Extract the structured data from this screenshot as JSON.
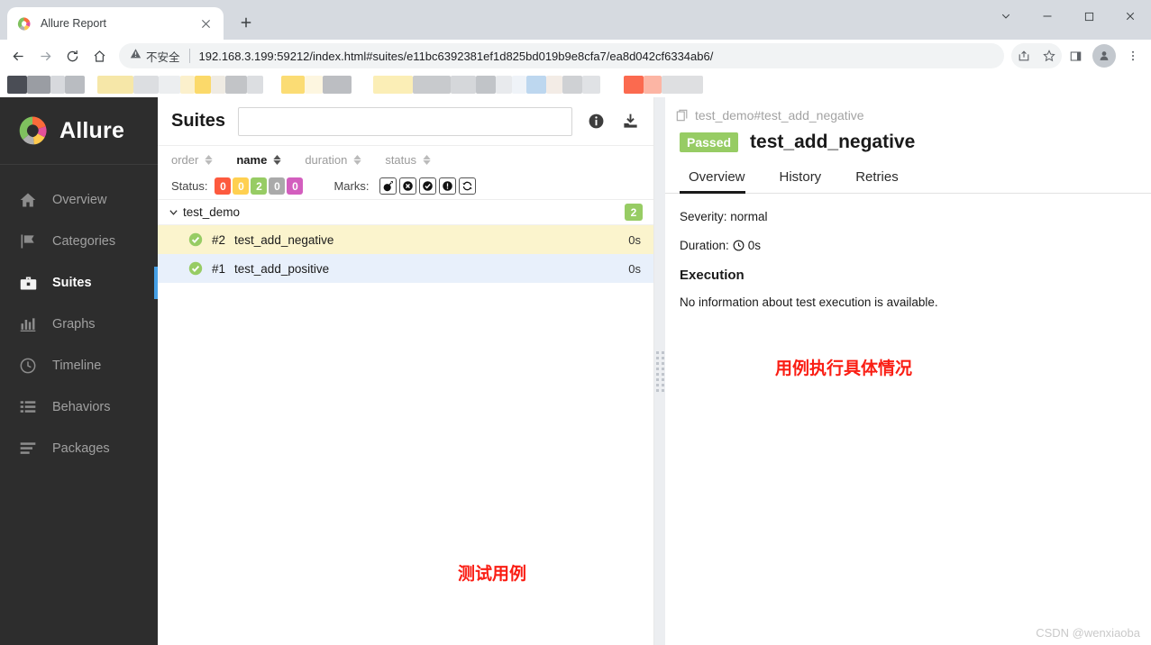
{
  "browser": {
    "tab": {
      "title": "Allure Report",
      "favicon": "allure-logo-icon",
      "close": "×"
    },
    "new_tab_label": "+",
    "window_controls": [
      {
        "name": "tab-search",
        "glyph": "chevron-down"
      },
      {
        "name": "minimize",
        "glyph": "minimize"
      },
      {
        "name": "maximize",
        "glyph": "maximize"
      },
      {
        "name": "close",
        "glyph": "close"
      }
    ],
    "omnibox": {
      "security_label": "不安全",
      "security_icon": "warning-triangle-icon",
      "url": "192.168.3.199:59212/index.html#suites/e11bc6392381ef1d825bd019b9e8cfa7/ea8d042cf6334ab6/"
    },
    "toolbar_icons": [
      "back-icon",
      "forward-icon",
      "reload-icon",
      "home-icon"
    ],
    "toolbar_right_icons": [
      "share-icon",
      "bookmark-star-icon",
      "side-panel-icon",
      "profile-avatar",
      "chrome-menu-icon"
    ]
  },
  "sidebar": {
    "brand": "Allure",
    "items": [
      {
        "label": "Overview",
        "icon": "home-icon",
        "active": false
      },
      {
        "label": "Categories",
        "icon": "flag-icon",
        "active": false
      },
      {
        "label": "Suites",
        "icon": "briefcase-icon",
        "active": true
      },
      {
        "label": "Graphs",
        "icon": "bar-chart-icon",
        "active": false
      },
      {
        "label": "Timeline",
        "icon": "clock-icon",
        "active": false
      },
      {
        "label": "Behaviors",
        "icon": "list-icon",
        "active": false
      },
      {
        "label": "Packages",
        "icon": "layers-icon",
        "active": false
      }
    ],
    "active_accent": "#46a0e6"
  },
  "suites": {
    "title": "Suites",
    "search_value": "",
    "search_placeholder": "",
    "header_icons": [
      "info-icon",
      "download-icon"
    ],
    "sort": [
      {
        "label": "order",
        "active": false
      },
      {
        "label": "name",
        "active": true
      },
      {
        "label": "duration",
        "active": false
      },
      {
        "label": "status",
        "active": false
      }
    ],
    "status_label": "Status:",
    "status_chips": [
      {
        "value": "0",
        "color": "#fd5a3e"
      },
      {
        "value": "0",
        "color": "#ffd050"
      },
      {
        "value": "2",
        "color": "#97cc64"
      },
      {
        "value": "0",
        "color": "#aaaaaa"
      },
      {
        "value": "0",
        "color": "#d35ebe"
      }
    ],
    "marks_label": "Marks:",
    "marks": [
      "flaky-bomb-icon",
      "known-issue-x-icon",
      "muted-check-icon",
      "blocker-exclamation-icon",
      "retry-refresh-icon"
    ],
    "tree": {
      "node_label": "test_demo",
      "node_count": "2",
      "caret": "chevron-down-icon",
      "tests": [
        {
          "order": "#2",
          "name": "test_add_negative",
          "duration": "0s",
          "status": "passed",
          "selected": true
        },
        {
          "order": "#1",
          "name": "test_add_positive",
          "duration": "0s",
          "status": "passed",
          "selected": false
        }
      ]
    },
    "annotation": "测试用例"
  },
  "detail": {
    "breadcrumb": "test_demo#test_add_negative",
    "breadcrumb_icon": "copy-icon",
    "status_badge": "Passed",
    "status_badge_color": "#97cc64",
    "title": "test_add_negative",
    "tabs": [
      {
        "label": "Overview",
        "active": true
      },
      {
        "label": "History",
        "active": false
      },
      {
        "label": "Retries",
        "active": false
      }
    ],
    "severity": "Severity: normal",
    "duration_label": "Duration:",
    "duration_icon": "clock-icon",
    "duration_value": "0s",
    "execution_title": "Execution",
    "execution_text": "No information about test execution is available.",
    "annotation": "用例执行具体情况"
  },
  "watermark": "CSDN @wenxiaoba"
}
